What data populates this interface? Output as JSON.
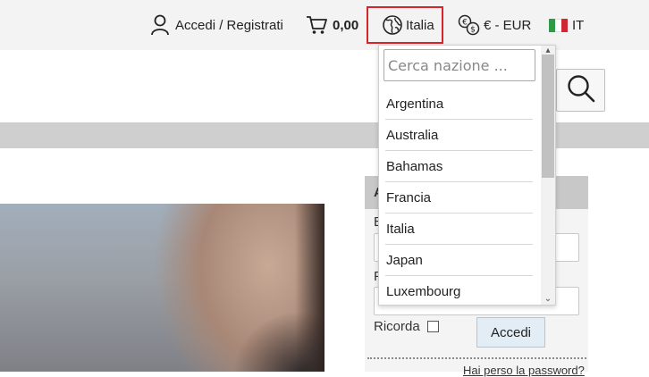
{
  "topbar": {
    "account_label": "Accedi / Registrati",
    "cart_amount": "0,00",
    "country_label": "Italia",
    "currency_label": "€ - EUR",
    "language_label": "IT"
  },
  "country_dropdown": {
    "search_placeholder": "Cerca nazione ...",
    "items": [
      "Argentina",
      "Australia",
      "Bahamas",
      "Francia",
      "Italia",
      "Japan",
      "Luxembourg"
    ]
  },
  "login": {
    "header_letter": "A",
    "field1_label_letter": "E",
    "field2_label_letter": "P",
    "remember_label": "Ricorda",
    "submit_label": "Accedi",
    "forgot_link": "Hai perso la password?"
  },
  "colors": {
    "topbar_bg": "#f3f3f3",
    "highlight_border": "#d9232a",
    "band": "#cfcfcf"
  },
  "icons": [
    "user-icon",
    "cart-icon",
    "globe-icon",
    "currency-exchange-icon",
    "italy-flag-icon",
    "search-icon"
  ]
}
